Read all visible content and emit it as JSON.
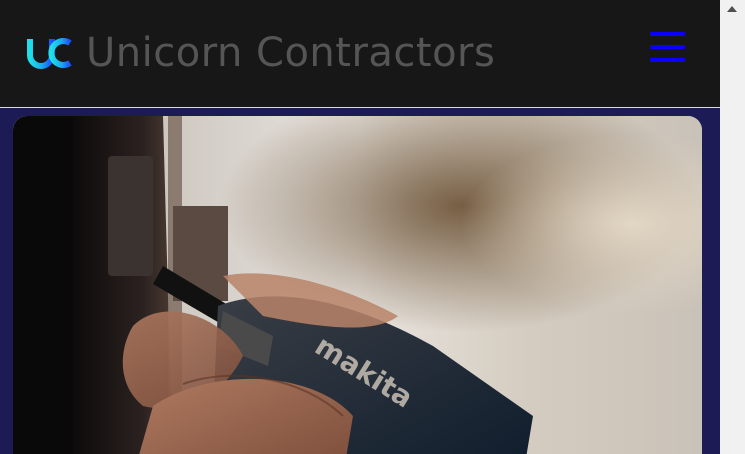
{
  "header": {
    "brand_name": "Unicorn Contractors",
    "logo_icon": "uc-monogram-icon",
    "menu_icon": "hamburger-menu-icon"
  },
  "hero": {
    "image_description_icon": "power-drill-photo"
  },
  "colors": {
    "navbar_bg": "#171717",
    "page_bg": "#1d1b56",
    "brand_text": "#555555",
    "logo_cyan": "#1fe0e8",
    "logo_blue": "#1a4dff",
    "menu_blue": "#0b00ff"
  },
  "scrollbar": {
    "up_icon": "scroll-up-arrow-icon"
  }
}
